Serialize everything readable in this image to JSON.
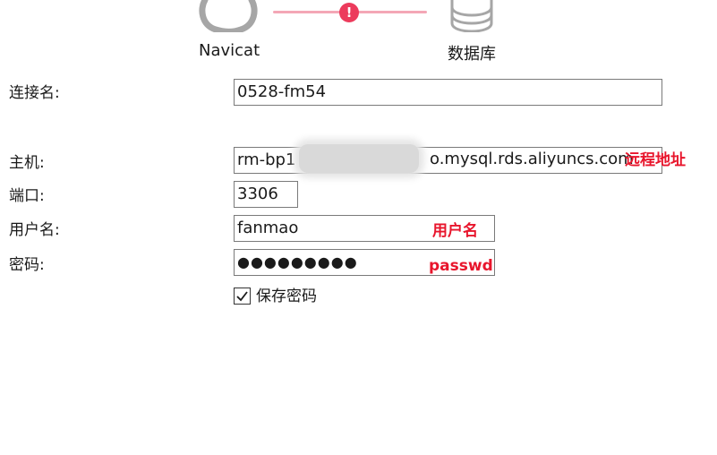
{
  "header": {
    "app_label": "Navicat",
    "db_label": "数据库",
    "alert_glyph": "!",
    "icons": [
      "navicat-icon",
      "alert-icon",
      "database-icon"
    ],
    "line_color": "#f4a7b6",
    "alert_color": "#ec3b5c"
  },
  "form": {
    "conn_name": {
      "label": "连接名:",
      "value": "0528-fm54"
    },
    "host": {
      "label": "主机:",
      "value_prefix": "rm-bp1",
      "value_suffix": "o.mysql.rds.aliyuncs.com",
      "annotation": "远程地址"
    },
    "port": {
      "label": "端口:",
      "value": "3306"
    },
    "user": {
      "label": "用户名:",
      "value": "fanmao",
      "annotation": "用户名"
    },
    "password": {
      "label": "密码:",
      "masked": "●●●●●●●●●",
      "annotation": "passwd"
    },
    "save_password": {
      "label": "保存密码",
      "checked": true
    }
  },
  "colors": {
    "annotation": "#e8152c"
  }
}
